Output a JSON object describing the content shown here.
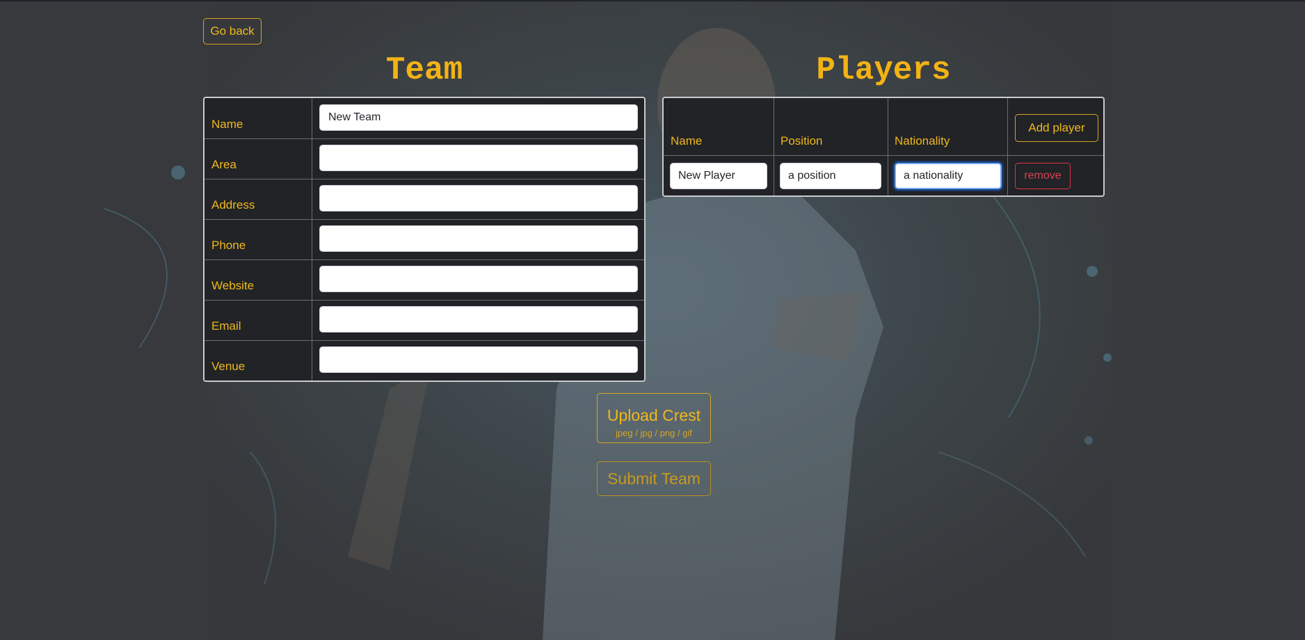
{
  "nav": {
    "go_back_label": "Go back"
  },
  "team": {
    "heading": "Team",
    "fields": [
      {
        "label": "Name",
        "value": "New Team"
      },
      {
        "label": "Area",
        "value": ""
      },
      {
        "label": "Address",
        "value": ""
      },
      {
        "label": "Phone",
        "value": ""
      },
      {
        "label": "Website",
        "value": ""
      },
      {
        "label": "Email",
        "value": ""
      },
      {
        "label": "Venue",
        "value": ""
      }
    ]
  },
  "players": {
    "heading": "Players",
    "columns": [
      "Name",
      "Position",
      "Nationality"
    ],
    "add_player_label": "Add player",
    "rows": [
      {
        "name": "New Player",
        "position": "a position",
        "nationality": "a nationality",
        "remove_label": "remove"
      }
    ]
  },
  "actions": {
    "upload_crest_label": "Upload Crest",
    "upload_crest_formats": "jpeg / jpg / png / gif",
    "submit_team_label": "Submit Team"
  },
  "colors": {
    "accent": "#f0b81c",
    "danger": "#dc3545",
    "panel_bg": "#212327",
    "page_bg": "#3a3c3f"
  }
}
